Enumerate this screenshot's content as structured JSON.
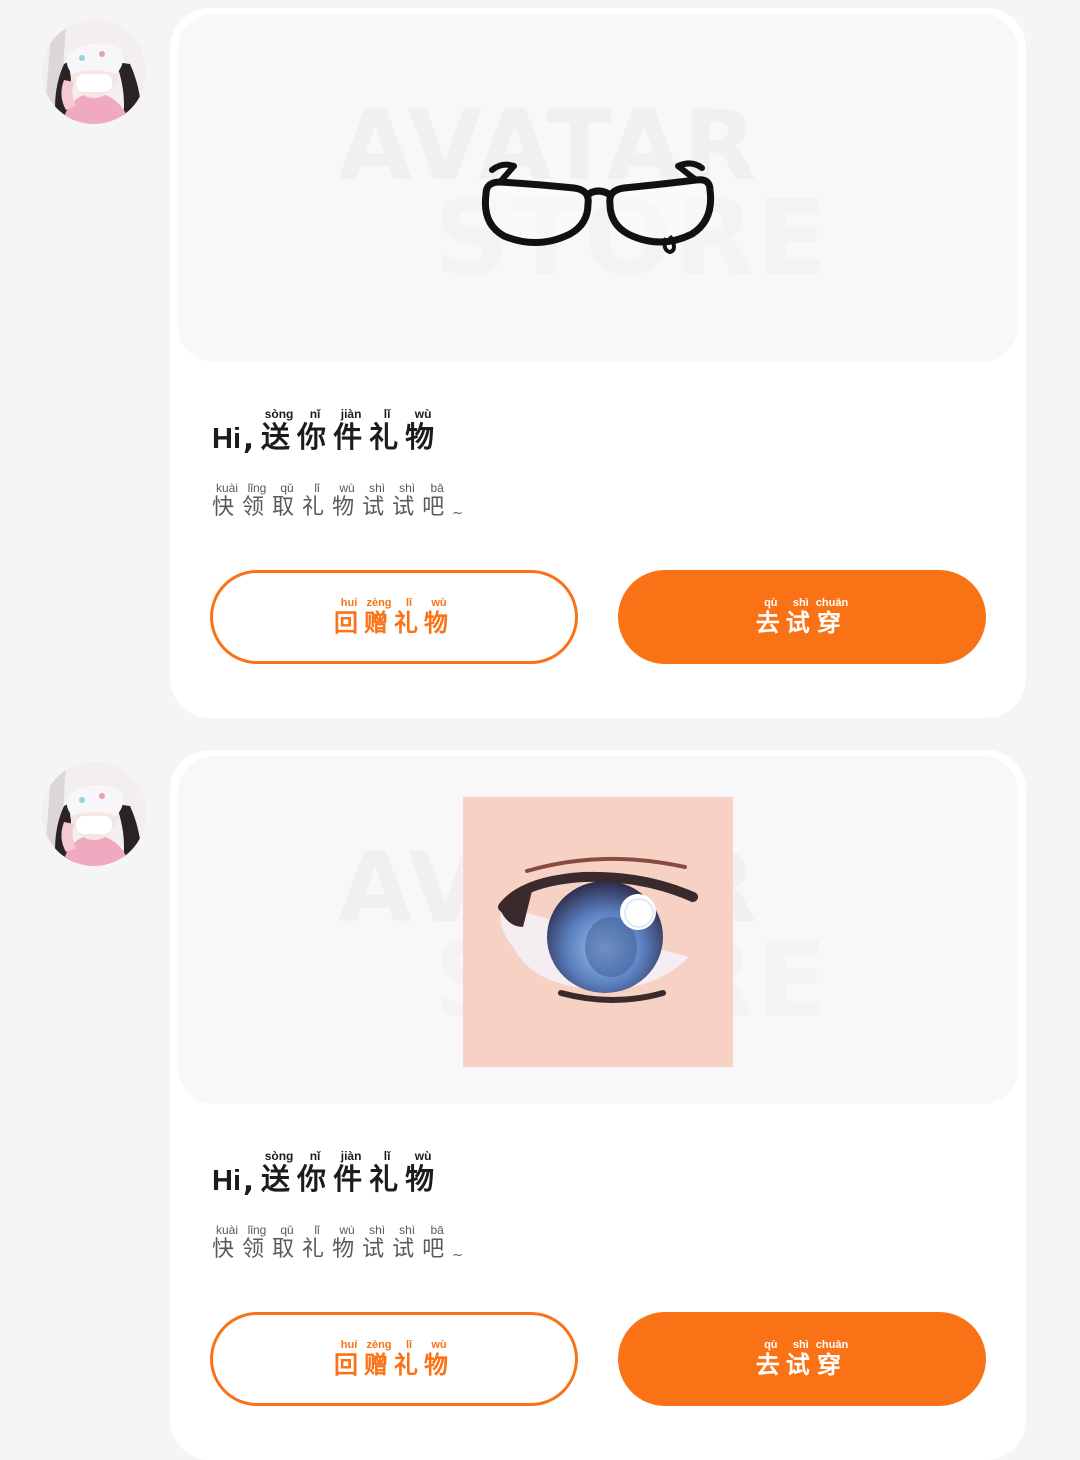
{
  "messages": [
    {
      "item": "glasses",
      "watermark": {
        "line1": "AVATAR",
        "line2": "STORE"
      },
      "title": {
        "prefix": "Hi",
        "chars": [
          {
            "char": "送",
            "pinyin": "sòng"
          },
          {
            "char": "你",
            "pinyin": "nǐ"
          },
          {
            "char": "件",
            "pinyin": "jiàn"
          },
          {
            "char": "礼",
            "pinyin": "lǐ"
          },
          {
            "char": "物",
            "pinyin": "wù"
          }
        ]
      },
      "subtitle": {
        "chars": [
          {
            "char": "快",
            "pinyin": "kuài"
          },
          {
            "char": "领",
            "pinyin": "lǐng"
          },
          {
            "char": "取",
            "pinyin": "qǔ"
          },
          {
            "char": "礼",
            "pinyin": "lǐ"
          },
          {
            "char": "物",
            "pinyin": "wù"
          },
          {
            "char": "试",
            "pinyin": "shì"
          },
          {
            "char": "试",
            "pinyin": "shì"
          },
          {
            "char": "吧",
            "pinyin": "bā"
          }
        ],
        "suffix": "~"
      },
      "return_gift_button": {
        "chars": [
          {
            "char": "回",
            "pinyin": "huí"
          },
          {
            "char": "赠",
            "pinyin": "zèng"
          },
          {
            "char": "礼",
            "pinyin": "lǐ"
          },
          {
            "char": "物",
            "pinyin": "wù"
          }
        ]
      },
      "try_on_button": {
        "chars": [
          {
            "char": "去",
            "pinyin": "qù"
          },
          {
            "char": "试",
            "pinyin": "shì"
          },
          {
            "char": "穿",
            "pinyin": "chuān"
          }
        ]
      }
    },
    {
      "item": "eye",
      "watermark": {
        "line1": "AVATAR",
        "line2": "STORE"
      },
      "title": {
        "prefix": "Hi",
        "chars": [
          {
            "char": "送",
            "pinyin": "sòng"
          },
          {
            "char": "你",
            "pinyin": "nǐ"
          },
          {
            "char": "件",
            "pinyin": "jiàn"
          },
          {
            "char": "礼",
            "pinyin": "lǐ"
          },
          {
            "char": "物",
            "pinyin": "wù"
          }
        ]
      },
      "subtitle": {
        "chars": [
          {
            "char": "快",
            "pinyin": "kuài"
          },
          {
            "char": "领",
            "pinyin": "lǐng"
          },
          {
            "char": "取",
            "pinyin": "qǔ"
          },
          {
            "char": "礼",
            "pinyin": "lǐ"
          },
          {
            "char": "物",
            "pinyin": "wù"
          },
          {
            "char": "试",
            "pinyin": "shì"
          },
          {
            "char": "试",
            "pinyin": "shì"
          },
          {
            "char": "吧",
            "pinyin": "bā"
          }
        ],
        "suffix": "~"
      },
      "return_gift_button": {
        "chars": [
          {
            "char": "回",
            "pinyin": "huí"
          },
          {
            "char": "赠",
            "pinyin": "zèng"
          },
          {
            "char": "礼",
            "pinyin": "lǐ"
          },
          {
            "char": "物",
            "pinyin": "wù"
          }
        ]
      },
      "try_on_button": {
        "chars": [
          {
            "char": "去",
            "pinyin": "qù"
          },
          {
            "char": "试",
            "pinyin": "shì"
          },
          {
            "char": "穿",
            "pinyin": "chuān"
          }
        ]
      }
    }
  ],
  "colors": {
    "accent": "#f97316",
    "page_background": "#f5f5f6",
    "card_background": "#ffffff",
    "preview_background": "#f8f8fa"
  }
}
